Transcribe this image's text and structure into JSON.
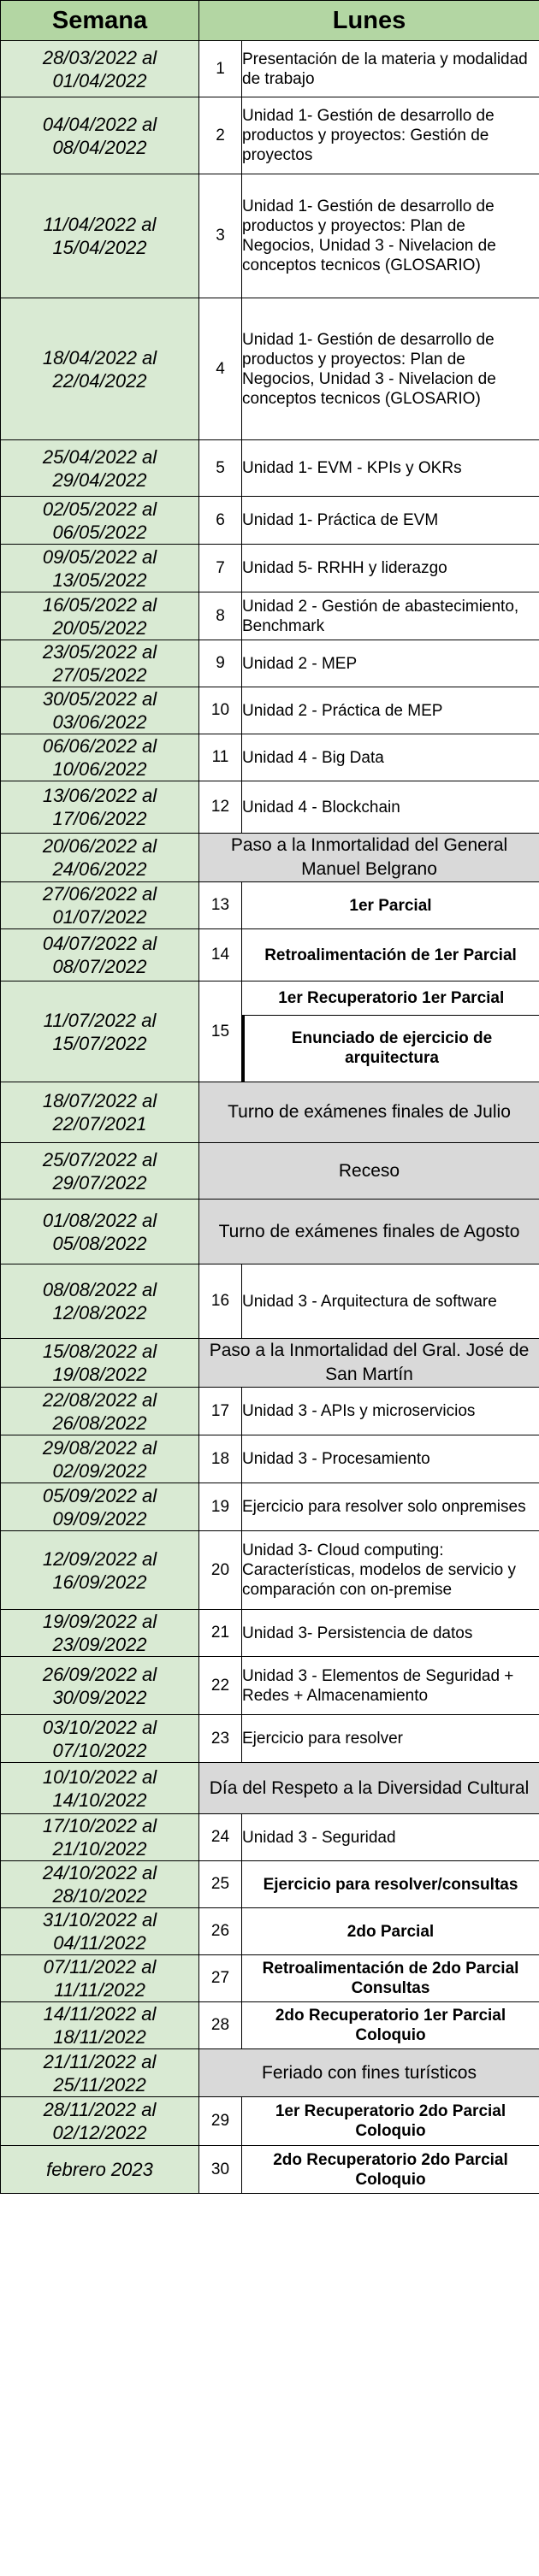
{
  "header": {
    "week": "Semana",
    "day": "Lunes"
  },
  "rows": [
    {
      "week": "28/03/2022 al 01/04/2022",
      "num": "1",
      "topic": "Presentación de la materia y modalidad de trabajo"
    },
    {
      "week": "04/04/2022 al 08/04/2022",
      "num": "2",
      "topic": "Unidad 1- Gestión de desarrollo de productos y proyectos: Gestión de proyectos"
    },
    {
      "week": "11/04/2022 al 15/04/2022",
      "num": "3",
      "topic": "Unidad 1- Gestión de desarrollo de productos y proyectos: Plan de Negocios, Unidad 3 - Nivelacion de conceptos tecnicos (GLOSARIO)"
    },
    {
      "week": "18/04/2022 al 22/04/2022",
      "num": "4",
      "topic": "Unidad 1- Gestión de desarrollo de productos y proyectos: Plan de Negocios, Unidad 3 - Nivelacion de conceptos tecnicos (GLOSARIO)"
    },
    {
      "week": "25/04/2022 al 29/04/2022",
      "num": "5",
      "topic": "Unidad 1- EVM - KPIs y OKRs"
    },
    {
      "week": "02/05/2022 al 06/05/2022",
      "num": "6",
      "topic": "Unidad 1- Práctica de EVM"
    },
    {
      "week": "09/05/2022 al 13/05/2022",
      "num": "7",
      "topic": "Unidad 5- RRHH y liderazgo"
    },
    {
      "week": "16/05/2022 al 20/05/2022",
      "num": "8",
      "topic": "Unidad 2 - Gestión de abastecimiento, Benchmark"
    },
    {
      "week": "23/05/2022 al 27/05/2022",
      "num": "9",
      "topic": "Unidad 2 - MEP"
    },
    {
      "week": "30/05/2022 al 03/06/2022",
      "num": "10",
      "topic": "Unidad 2 - Práctica de MEP"
    },
    {
      "week": "06/06/2022 al 10/06/2022",
      "num": "11",
      "topic": "Unidad 4 - Big Data"
    },
    {
      "week": "13/06/2022 al 17/06/2022",
      "num": "12",
      "topic": "Unidad 4 - Blockchain"
    },
    {
      "week": "20/06/2022 al 24/06/2022",
      "event": "Paso a la Inmortalidad del General Manuel Belgrano"
    },
    {
      "week": "27/06/2022 al 01/07/2022",
      "num": "13",
      "topic": "1er Parcial"
    },
    {
      "week": "04/07/2022 al 08/07/2022",
      "num": "14",
      "topic": "Retroalimentación de 1er Parcial"
    },
    {
      "week": "11/07/2022 al 15/07/2022",
      "num": "15",
      "topic": "1er Recuperatorio 1er Parcial",
      "topic2": "Enunciado de ejercicio de arquitectura"
    },
    {
      "week": "18/07/2022 al 22/07/2021",
      "event": "Turno de exámenes finales de Julio"
    },
    {
      "week": "25/07/2022 al 29/07/2022",
      "event": "Receso"
    },
    {
      "week": "01/08/2022 al 05/08/2022",
      "event": "Turno de exámenes finales de Agosto"
    },
    {
      "week": "08/08/2022 al 12/08/2022",
      "num": "16",
      "topic": "Unidad 3 - Arquitectura de software"
    },
    {
      "week": "15/08/2022 al 19/08/2022",
      "event": "Paso a la Inmortalidad del Gral. José de San Martín"
    },
    {
      "week": "22/08/2022 al 26/08/2022",
      "num": "17",
      "topic": "Unidad 3 - APIs y microservicios"
    },
    {
      "week": "29/08/2022 al 02/09/2022",
      "num": "18",
      "topic": "Unidad 3 - Procesamiento"
    },
    {
      "week": "05/09/2022 al 09/09/2022",
      "num": "19",
      "topic": "Ejercicio para resolver solo onpremises"
    },
    {
      "week": "12/09/2022 al 16/09/2022",
      "num": "20",
      "topic": "Unidad 3- Cloud computing: Características, modelos de servicio y comparación con on-premise"
    },
    {
      "week": "19/09/2022 al 23/09/2022",
      "num": "21",
      "topic": "Unidad 3- Persistencia de datos"
    },
    {
      "week": "26/09/2022 al 30/09/2022",
      "num": "22",
      "topic": "Unidad 3 - Elementos de Seguridad + Redes + Almacenamiento"
    },
    {
      "week": "03/10/2022 al 07/10/2022",
      "num": "23",
      "topic": "Ejercicio para resolver"
    },
    {
      "week": "10/10/2022 al 14/10/2022",
      "event": "Día del Respeto a la Diversidad Cultural"
    },
    {
      "week": "17/10/2022 al 21/10/2022",
      "num": "24",
      "topic": "Unidad 3 - Seguridad"
    },
    {
      "week": "24/10/2022 al 28/10/2022",
      "num": "25",
      "topic": "Ejercicio para resolver/consultas"
    },
    {
      "week": "31/10/2022 al 04/11/2022",
      "num": "26",
      "topic": "2do Parcial"
    },
    {
      "week": "07/11/2022 al 11/11/2022",
      "num": "27",
      "topic": "Retroalimentación de 2do Parcial Consultas"
    },
    {
      "week": "14/11/2022 al 18/11/2022",
      "num": "28",
      "topic": "2do Recuperatorio 1er Parcial Coloquio"
    },
    {
      "week": "21/11/2022 al 25/11/2022",
      "event": "Feriado con fines turísticos"
    },
    {
      "week": "28/11/2022 al 02/12/2022",
      "num": "29",
      "topic": "1er Recuperatorio 2do Parcial Coloquio"
    },
    {
      "week": "febrero 2023",
      "num": "30",
      "topic": "2do Recuperatorio 2do Parcial Coloquio"
    }
  ]
}
